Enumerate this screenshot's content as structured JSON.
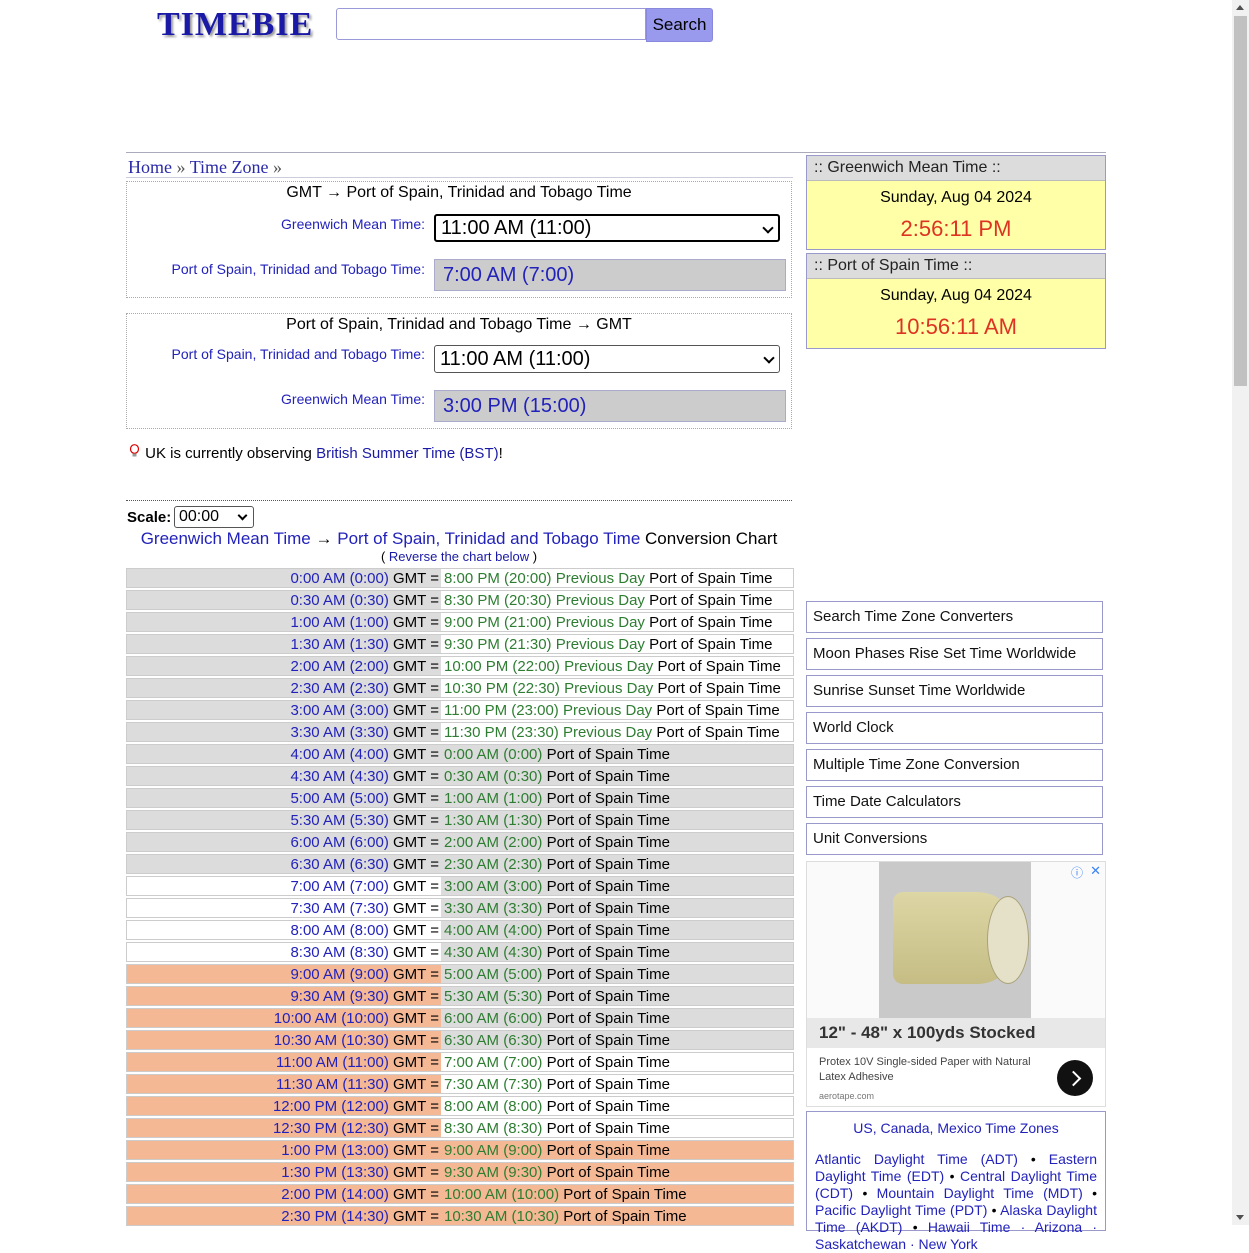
{
  "header": {
    "logo": "TIMEBIE",
    "search_placeholder": "",
    "search_label": "Search"
  },
  "breadcrumb": {
    "home": "Home",
    "sep1": "»",
    "timezone": "Time Zone",
    "sep2": "»"
  },
  "converter1": {
    "title": "GMT → Port of Spain, Trinidad and Tobago Time",
    "from_label": "Greenwich Mean Time:",
    "from_value": "11:00 AM (11:00)",
    "to_label": "Port of Spain, Trinidad and Tobago Time:",
    "to_value": "7:00 AM (7:00)"
  },
  "converter2": {
    "title": "Port of Spain, Trinidad and Tobago Time → GMT",
    "from_label": "Port of Spain, Trinidad and Tobago Time:",
    "from_value": "11:00 AM (11:00)",
    "to_label": "Greenwich Mean Time:",
    "to_value": "3:00 PM (15:00)"
  },
  "notice": {
    "prefix": "UK is currently observing ",
    "link": "British Summer Time (BST)",
    "suffix": "!"
  },
  "scale": {
    "label": "Scale:",
    "value": "00:00"
  },
  "chart": {
    "from_zone": "Greenwich Mean Time",
    "arrow": "→",
    "to_zone": "Port of Spain, Trinidad and Tobago Time",
    "suffix": "Conversion Chart",
    "reverse_open": "(",
    "reverse_link": "Reverse the chart below",
    "reverse_close": ")",
    "gmt_word": "GMT =",
    "pos_word": "Port of Spain Time",
    "rows": [
      {
        "gmt": "0:00 AM (0:00)",
        "pos": "8:00 PM (20:00)",
        "prev": "Previous Day",
        "l": "gray",
        "r": "white"
      },
      {
        "gmt": "0:30 AM (0:30)",
        "pos": "8:30 PM (20:30)",
        "prev": "Previous Day",
        "l": "gray",
        "r": "white"
      },
      {
        "gmt": "1:00 AM (1:00)",
        "pos": "9:00 PM (21:00)",
        "prev": "Previous Day",
        "l": "gray",
        "r": "white"
      },
      {
        "gmt": "1:30 AM (1:30)",
        "pos": "9:30 PM (21:30)",
        "prev": "Previous Day",
        "l": "gray",
        "r": "white"
      },
      {
        "gmt": "2:00 AM (2:00)",
        "pos": "10:00 PM (22:00)",
        "prev": "Previous Day",
        "l": "gray",
        "r": "white"
      },
      {
        "gmt": "2:30 AM (2:30)",
        "pos": "10:30 PM (22:30)",
        "prev": "Previous Day",
        "l": "gray",
        "r": "white"
      },
      {
        "gmt": "3:00 AM (3:00)",
        "pos": "11:00 PM (23:00)",
        "prev": "Previous Day",
        "l": "gray",
        "r": "white"
      },
      {
        "gmt": "3:30 AM (3:30)",
        "pos": "11:30 PM (23:30)",
        "prev": "Previous Day",
        "l": "gray",
        "r": "white"
      },
      {
        "gmt": "4:00 AM (4:00)",
        "pos": "0:00 AM (0:00)",
        "prev": "",
        "l": "gray",
        "r": "gray"
      },
      {
        "gmt": "4:30 AM (4:30)",
        "pos": "0:30 AM (0:30)",
        "prev": "",
        "l": "gray",
        "r": "gray"
      },
      {
        "gmt": "5:00 AM (5:00)",
        "pos": "1:00 AM (1:00)",
        "prev": "",
        "l": "gray",
        "r": "gray"
      },
      {
        "gmt": "5:30 AM (5:30)",
        "pos": "1:30 AM (1:30)",
        "prev": "",
        "l": "gray",
        "r": "gray"
      },
      {
        "gmt": "6:00 AM (6:00)",
        "pos": "2:00 AM (2:00)",
        "prev": "",
        "l": "gray",
        "r": "gray"
      },
      {
        "gmt": "6:30 AM (6:30)",
        "pos": "2:30 AM (2:30)",
        "prev": "",
        "l": "gray",
        "r": "gray"
      },
      {
        "gmt": "7:00 AM (7:00)",
        "pos": "3:00 AM (3:00)",
        "prev": "",
        "l": "white",
        "r": "gray"
      },
      {
        "gmt": "7:30 AM (7:30)",
        "pos": "3:30 AM (3:30)",
        "prev": "",
        "l": "white",
        "r": "gray"
      },
      {
        "gmt": "8:00 AM (8:00)",
        "pos": "4:00 AM (4:00)",
        "prev": "",
        "l": "white",
        "r": "gray"
      },
      {
        "gmt": "8:30 AM (8:30)",
        "pos": "4:30 AM (4:30)",
        "prev": "",
        "l": "white",
        "r": "gray"
      },
      {
        "gmt": "9:00 AM (9:00)",
        "pos": "5:00 AM (5:00)",
        "prev": "",
        "l": "orange",
        "r": "gray"
      },
      {
        "gmt": "9:30 AM (9:30)",
        "pos": "5:30 AM (5:30)",
        "prev": "",
        "l": "orange",
        "r": "gray"
      },
      {
        "gmt": "10:00 AM (10:00)",
        "pos": "6:00 AM (6:00)",
        "prev": "",
        "l": "orange",
        "r": "gray"
      },
      {
        "gmt": "10:30 AM (10:30)",
        "pos": "6:30 AM (6:30)",
        "prev": "",
        "l": "orange",
        "r": "gray"
      },
      {
        "gmt": "11:00 AM (11:00)",
        "pos": "7:00 AM (7:00)",
        "prev": "",
        "l": "orange",
        "r": "white"
      },
      {
        "gmt": "11:30 AM (11:30)",
        "pos": "7:30 AM (7:30)",
        "prev": "",
        "l": "orange",
        "r": "white"
      },
      {
        "gmt": "12:00 PM (12:00)",
        "pos": "8:00 AM (8:00)",
        "prev": "",
        "l": "orange",
        "r": "white"
      },
      {
        "gmt": "12:30 PM (12:30)",
        "pos": "8:30 AM (8:30)",
        "prev": "",
        "l": "orange",
        "r": "white"
      },
      {
        "gmt": "1:00 PM (13:00)",
        "pos": "9:00 AM (9:00)",
        "prev": "",
        "l": "orange",
        "r": "orange"
      },
      {
        "gmt": "1:30 PM (13:30)",
        "pos": "9:30 AM (9:30)",
        "prev": "",
        "l": "orange",
        "r": "orange"
      },
      {
        "gmt": "2:00 PM (14:00)",
        "pos": "10:00 AM (10:00)",
        "prev": "",
        "l": "orange",
        "r": "orange"
      },
      {
        "gmt": "2:30 PM (14:30)",
        "pos": "10:30 AM (10:30)",
        "prev": "",
        "l": "orange",
        "r": "orange"
      }
    ]
  },
  "clock1": {
    "header": ":: Greenwich Mean Time ::",
    "date": "Sunday, Aug 04 2024",
    "time": "2:56:11 PM"
  },
  "clock2": {
    "header": ":: Port of Spain Time ::",
    "date": "Sunday, Aug 04 2024",
    "time": "10:56:11 AM"
  },
  "links": [
    "Search Time Zone Converters",
    "Moon Phases Rise Set Time Worldwide",
    "Sunrise Sunset Time Worldwide",
    "World Clock",
    "Multiple Time Zone Conversion",
    "Time Date Calculators",
    "Unit Conversions"
  ],
  "ad": {
    "headline": "12\" - 48\" x 100yds Stocked",
    "description": "Protex 10V Single-sided Paper with Natural Latex Adhesive",
    "domain": "aerotape.com",
    "info": "ⓘ",
    "close": "✕"
  },
  "zones": {
    "title": "US, Canada, Mexico Time Zones",
    "line1a": "Atlantic Daylight Time (ADT)",
    "line1b": "Eastern Daylight Time (EDT)",
    "line2a": "Central Daylight Time (CDT)",
    "line3a": "Mountain Daylight Time (MDT)",
    "line3b": "Pacific Daylight Time (PDT)",
    "line4a": "Alaska Daylight Time (AKDT)",
    "line5": "Hawaii Time · Arizona · Saskatchewan · New York",
    "bullet": "•"
  },
  "colors": {
    "accent_blue": "#2222bb",
    "green": "#2e7d32",
    "clock_red": "#dd3322",
    "highlight_orange": "#f5b895",
    "row_gray": "#dcdcdc",
    "clock_bg": "#ffffa8"
  }
}
